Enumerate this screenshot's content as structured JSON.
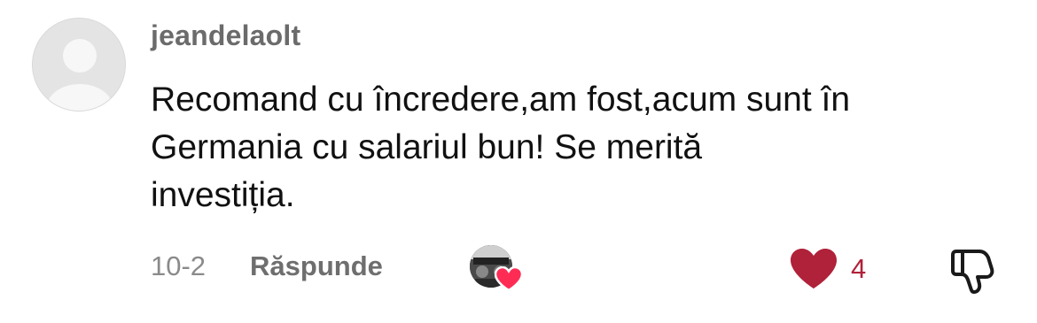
{
  "comment": {
    "username": "jeandelaolt",
    "text": "Recomand cu încredere,am fost,acum sunt în\nGermania cu salariul bun! Se merită\ninvestiția.",
    "date": "10-2",
    "reply_label": "Răspunde",
    "like_count": "4",
    "liked_by_creator": true
  },
  "icons": {
    "avatar": "default-user-avatar",
    "creator_avatar": "creator-avatar",
    "creator_heart": "heart-icon",
    "like": "heart-icon",
    "dislike": "thumbs-down-icon"
  },
  "colors": {
    "username": "#6b6b6b",
    "text": "#111111",
    "muted": "#8a8a8a",
    "like": "#b0213a",
    "creator_heart": "#fe2c55"
  }
}
